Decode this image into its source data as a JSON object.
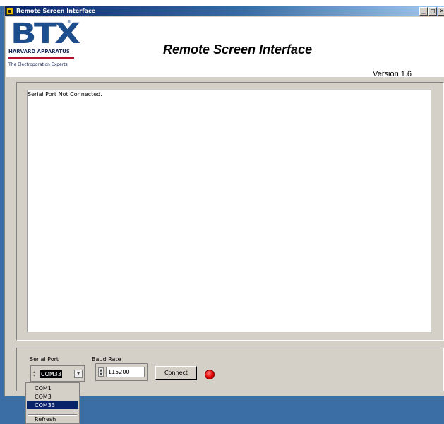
{
  "window": {
    "title": "Remote Screen Interface",
    "minimize_glyph": "_",
    "maximize_glyph": "□",
    "close_glyph": "×"
  },
  "header": {
    "logo_text": "BTX",
    "logo_registered": "®",
    "logo_company": "HARVARD APPARATUS",
    "logo_tagline": "The Electroporation Experts",
    "title": "Remote Screen Interface",
    "version": "Version 1.6"
  },
  "output": {
    "text": "Serial Port Not Connected."
  },
  "controls": {
    "serial_port_label": "Serial Port",
    "serial_port_value": "COM33",
    "baud_rate_label": "Baud Rate",
    "baud_rate_value": "115200",
    "connect_label": "Connect",
    "status_color": "#e00000"
  },
  "port_menu": {
    "items": [
      "COM1",
      "COM3",
      "COM33"
    ],
    "selected": "COM33",
    "refresh_label": "Refresh"
  },
  "colors": {
    "titlebar": "#0a246a",
    "window_bg": "#d4d0c8",
    "desktop": "#3a6ea5",
    "logo_blue": "#1c4d8c",
    "logo_red": "#b5122e"
  }
}
